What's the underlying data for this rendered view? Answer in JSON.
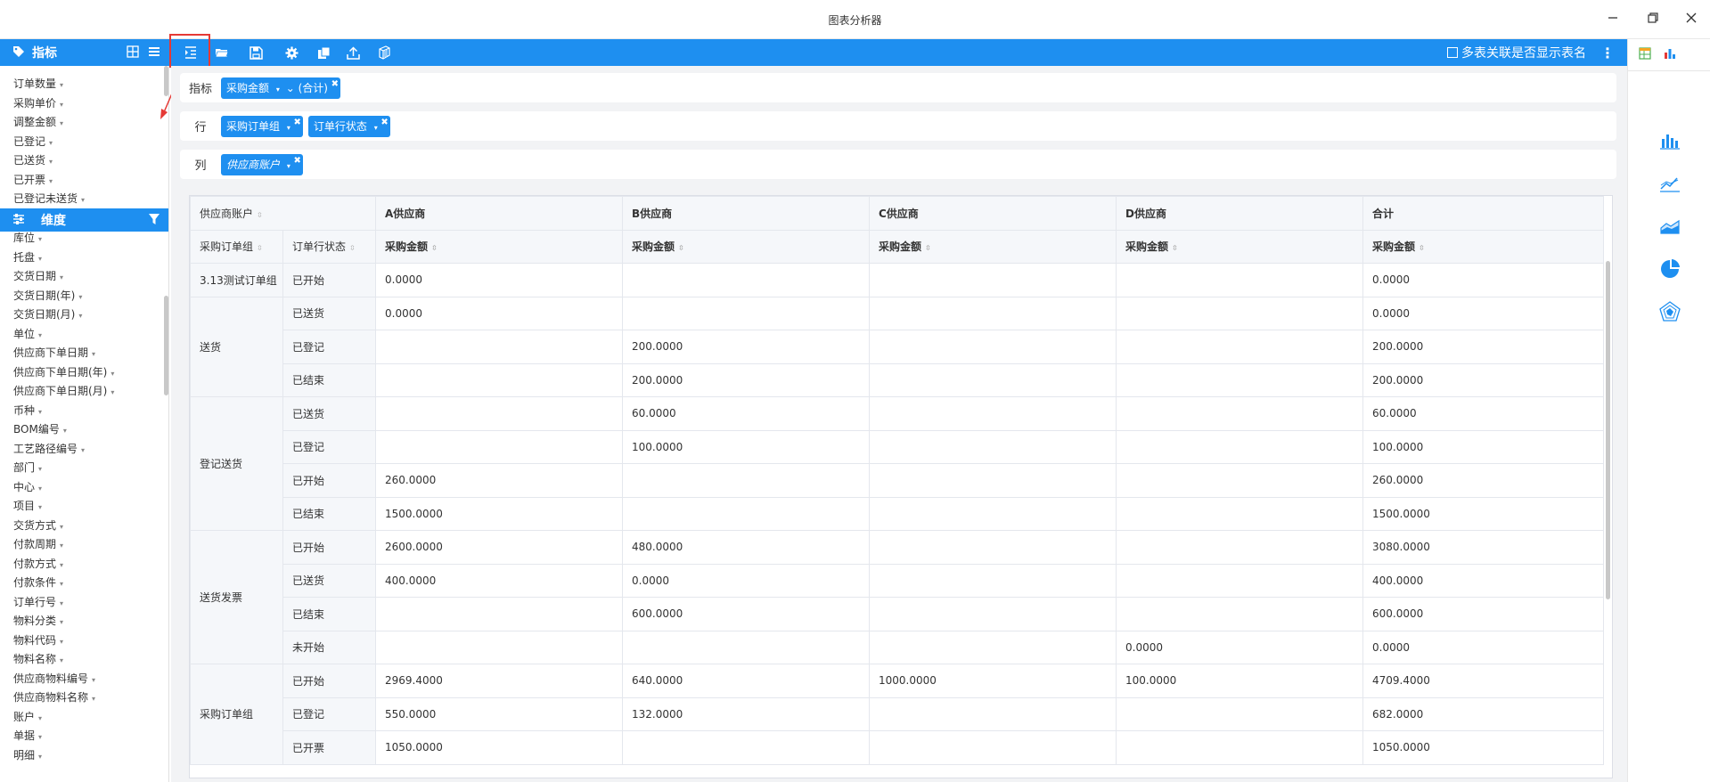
{
  "window": {
    "title": "图表分析器",
    "min_icon": "minimize-icon",
    "restore_icon": "restore-icon",
    "close_icon": "close-icon"
  },
  "toolbar": {
    "metrics_label": "指标",
    "right_checkbox_label": "多表关联是否显示表名",
    "icons": [
      "indent-icon",
      "open-folder-icon",
      "save-icon",
      "gear-icon",
      "copy-icon",
      "upload-icon",
      "cube-icon"
    ]
  },
  "sidebar": {
    "metrics": [
      "订单数量",
      "采购单价",
      "调整金额",
      "已登记",
      "已送货",
      "已开票",
      "已登记未送货"
    ],
    "dimensions_label": "维度",
    "dimensions": [
      "库位",
      "托盘",
      "交货日期",
      "交货日期(年)",
      "交货日期(月)",
      "单位",
      "供应商下单日期",
      "供应商下单日期(年)",
      "供应商下单日期(月)",
      "币种",
      "BOM编号",
      "工艺路径编号",
      "部门",
      "中心",
      "项目",
      "交货方式",
      "付款周期",
      "付款方式",
      "付款条件",
      "订单行号",
      "物料分类",
      "物料代码",
      "物料名称",
      "供应商物料编号",
      "供应商物料名称",
      "账户",
      "单据",
      "明细"
    ]
  },
  "filters": {
    "metric_label": "指标",
    "metric_pill": "采购金额",
    "metric_agg": "(合计)",
    "row_label": "行",
    "row_pills": [
      "采购订单组",
      "订单行状态"
    ],
    "col_label": "列",
    "col_pills": [
      "供应商账户"
    ]
  },
  "table": {
    "corner_label": "供应商账户",
    "suppliers": [
      "A供应商",
      "B供应商",
      "C供应商",
      "D供应商",
      "合计"
    ],
    "row_headers": [
      "采购订单组",
      "订单行状态"
    ],
    "measure": "采购金额",
    "rows": [
      {
        "group": "3.13测试订单组",
        "status": "已开始",
        "a": "0.0000",
        "b": "",
        "c": "",
        "d": "",
        "total": "0.0000"
      },
      {
        "group": "送货",
        "status": "已送货",
        "a": "0.0000",
        "b": "",
        "c": "",
        "d": "",
        "total": "0.0000"
      },
      {
        "group": "",
        "status": "已登记",
        "a": "",
        "b": "200.0000",
        "c": "",
        "d": "",
        "total": "200.0000"
      },
      {
        "group": "",
        "status": "已结束",
        "a": "",
        "b": "200.0000",
        "c": "",
        "d": "",
        "total": "200.0000"
      },
      {
        "group": "登记送货",
        "status": "已送货",
        "a": "",
        "b": "60.0000",
        "c": "",
        "d": "",
        "total": "60.0000"
      },
      {
        "group": "",
        "status": "已登记",
        "a": "",
        "b": "100.0000",
        "c": "",
        "d": "",
        "total": "100.0000"
      },
      {
        "group": "",
        "status": "已开始",
        "a": "260.0000",
        "b": "",
        "c": "",
        "d": "",
        "total": "260.0000"
      },
      {
        "group": "",
        "status": "已结束",
        "a": "1500.0000",
        "b": "",
        "c": "",
        "d": "",
        "total": "1500.0000"
      },
      {
        "group": "送货发票",
        "status": "已开始",
        "a": "2600.0000",
        "b": "480.0000",
        "c": "",
        "d": "",
        "total": "3080.0000"
      },
      {
        "group": "",
        "status": "已送货",
        "a": "400.0000",
        "b": "0.0000",
        "c": "",
        "d": "",
        "total": "400.0000"
      },
      {
        "group": "",
        "status": "已结束",
        "a": "",
        "b": "600.0000",
        "c": "",
        "d": "",
        "total": "600.0000"
      },
      {
        "group": "",
        "status": "未开始",
        "a": "",
        "b": "",
        "c": "",
        "d": "0.0000",
        "total": "0.0000"
      },
      {
        "group": "采购订单组",
        "status": "已开始",
        "a": "2969.4000",
        "b": "640.0000",
        "c": "1000.0000",
        "d": "100.0000",
        "total": "4709.4000"
      },
      {
        "group": "",
        "status": "已登记",
        "a": "550.0000",
        "b": "132.0000",
        "c": "",
        "d": "",
        "total": "682.0000"
      },
      {
        "group": "",
        "status": "已开票",
        "a": "1050.0000",
        "b": "",
        "c": "",
        "d": "",
        "total": "1050.0000"
      }
    ]
  },
  "right_panel": {
    "top_icons": [
      "table-view-icon",
      "chart-view-icon"
    ],
    "chart_icons": [
      "bar-chart-icon",
      "line-chart-icon",
      "area-chart-icon",
      "pie-chart-icon",
      "radar-chart-icon"
    ]
  },
  "colors": {
    "primary": "#1e8ff0",
    "highlight": "#e53935",
    "header_bg": "#f5f7fa"
  }
}
